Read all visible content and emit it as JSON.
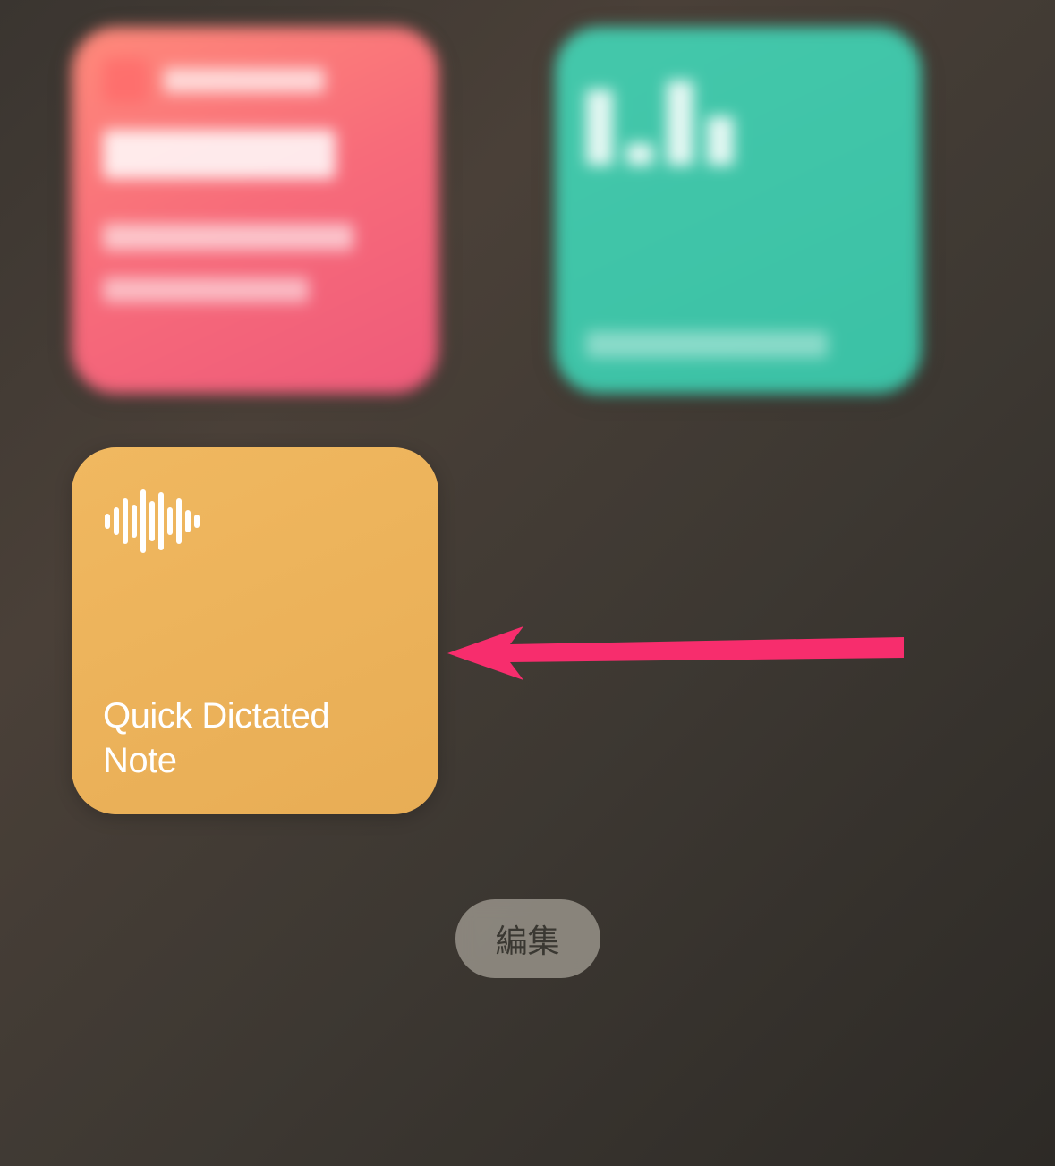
{
  "widgets": {
    "quick_dictated_note": {
      "title": "Quick Dictated Note"
    }
  },
  "edit_button_label": "編集",
  "colors": {
    "pink_widget": "#f76b7a",
    "teal_widget": "#3bc1a5",
    "orange_widget": "#e8ad55",
    "arrow": "#f72d6d"
  }
}
